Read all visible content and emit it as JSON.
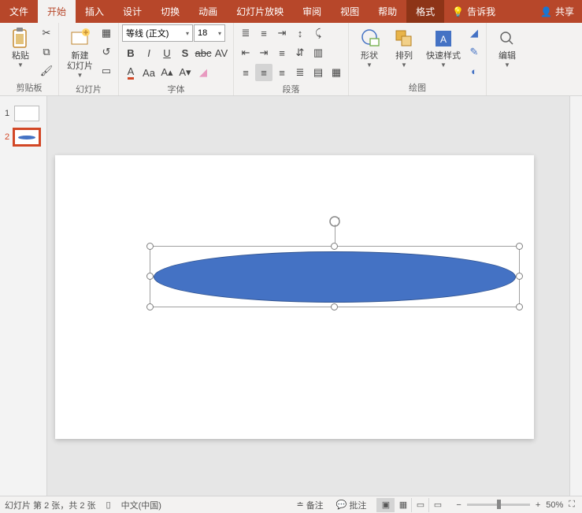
{
  "tabs": {
    "file": "文件",
    "home": "开始",
    "insert": "插入",
    "design": "设计",
    "transitions": "切换",
    "animations": "动画",
    "slideshow": "幻灯片放映",
    "review": "审阅",
    "view": "视图",
    "help": "帮助",
    "format": "格式"
  },
  "titlebar": {
    "tell_me": "告诉我",
    "share": "共享"
  },
  "groups": {
    "clipboard": "剪贴板",
    "slides": "幻灯片",
    "font": "字体",
    "paragraph": "段落",
    "drawing": "绘图"
  },
  "buttons": {
    "paste": "粘贴",
    "new_slide": "新建\n幻灯片",
    "shapes": "形状",
    "arrange": "排列",
    "quick_styles": "快速样式",
    "editing": "编辑"
  },
  "font": {
    "family": "等线 (正文)",
    "size": "18"
  },
  "thumbs": {
    "n1": "1",
    "n2": "2"
  },
  "status": {
    "slide_info": "幻灯片 第 2 张，共 2 张",
    "language": "中文(中国)",
    "notes": "备注",
    "comments": "批注",
    "zoom": "50%"
  }
}
